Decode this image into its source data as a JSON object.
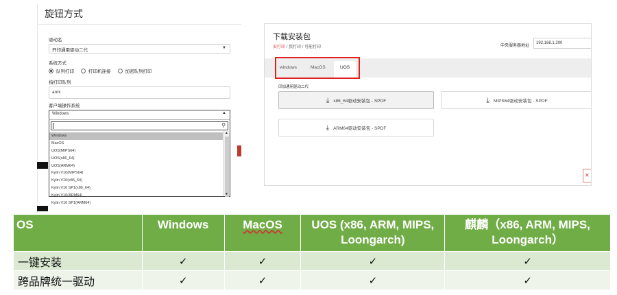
{
  "dialog": {
    "title": "旋钮方式",
    "driver_label": "驱动名",
    "driver_value": "开印通用驱动二代",
    "method_label": "系统方式",
    "radios": [
      {
        "label": "队列打印",
        "checked": true
      },
      {
        "label": "打印机连接",
        "checked": false
      },
      {
        "label": "加密队列打印",
        "checked": false
      }
    ],
    "queue_label": "指打印队列",
    "queue_value": "anni",
    "client_os_label": "客户端操作系统",
    "os_selected": "Windows",
    "os_options": [
      "Windows",
      "MacOS",
      "UOS(MIPS64)",
      "UOS(x86_64)",
      "UOS(ARM64)",
      "Kylin V10(MIPS64)",
      "Kylin V10(x86_64)",
      "Kylin V10 SP1(x86_64)",
      "Kylin V10(ARM64)",
      "Kylin V10 SP1(ARM64)"
    ]
  },
  "download": {
    "title": "下载安装包",
    "breadcrumb": [
      "安打印",
      "我打印",
      "可能打印"
    ],
    "server_label": "中央服务器地址",
    "server_value": "192.168.1.200",
    "tabs": [
      "windows",
      "MacOS",
      "UOS"
    ],
    "active_tab": "UOS",
    "section_label": "印加通用驱动二代",
    "buttons": [
      {
        "label": "x86_64驱动安装包 - SPDF"
      },
      {
        "label": "MIPS64驱动安装包 - SPDF"
      },
      {
        "label": "ARM64驱动安装包 - SPDF"
      }
    ]
  },
  "table": {
    "headers": [
      "OS",
      "Windows",
      "MacOS",
      "UOS (x86, ARM, MIPS, Loongarch)",
      "麒麟（x86, ARM, MIPS, Loongarch）"
    ],
    "rows": [
      {
        "label": "一键安装",
        "cells": [
          "✓",
          "✓",
          "✓",
          "✓"
        ]
      },
      {
        "label": "跨品牌统一驱动",
        "cells": [
          "✓",
          "✓",
          "✓",
          "✓"
        ]
      }
    ]
  },
  "colors": {
    "header_green": "#71ad47",
    "row_light": "#dbe9d2",
    "row_lighter": "#eef4ea",
    "highlight_red": "#e02020"
  }
}
